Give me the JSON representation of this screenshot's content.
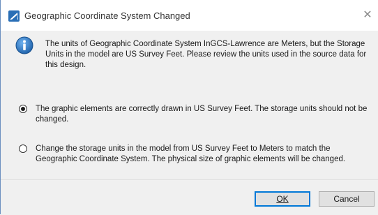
{
  "window": {
    "title": "Geographic Coordinate System Changed",
    "close_glyph": "✕",
    "app_icon": "microstation-icon"
  },
  "message": {
    "icon": "info-icon",
    "text": "The units of Geographic Coordinate System InGCS-Lawrence are Meters, but the Storage Units in the model are US Survey Feet. Please review the units used in the source data for this design."
  },
  "options": [
    {
      "label": "The graphic elements are correctly drawn in US Survey Feet. The storage units should not be changed.",
      "selected": true
    },
    {
      "label": "Change the storage units in the model from US Survey Feet to Meters to match the Geographic Coordinate System. The physical size of graphic elements will be changed.",
      "selected": false
    }
  ],
  "buttons": {
    "ok_label": "OK",
    "cancel_label": "Cancel"
  },
  "colors": {
    "accent": "#0078d7",
    "info_icon": "#1c5fa8"
  }
}
